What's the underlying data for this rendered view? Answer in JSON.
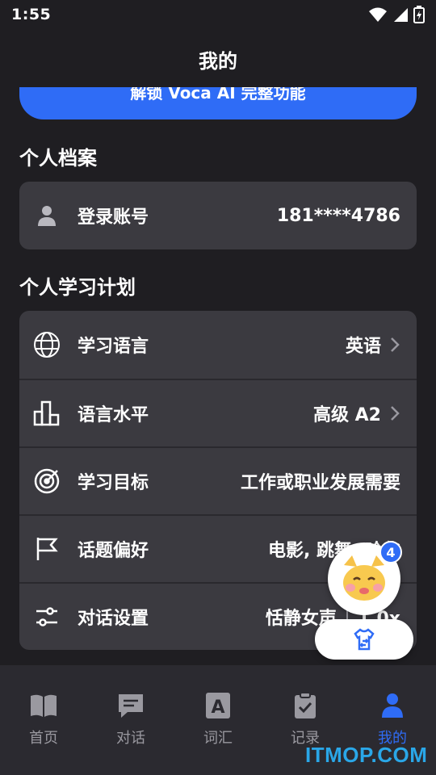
{
  "status": {
    "time": "1:55"
  },
  "header": {
    "title": "我的"
  },
  "unlock": {
    "label": "解锁 Voca AI 完整功能"
  },
  "profile": {
    "section_title": "个人档案",
    "account_label": "登录账号",
    "account_value": "181****4786"
  },
  "plan": {
    "section_title": "个人学习计划",
    "rows": [
      {
        "label": "学习语言",
        "value": "英语",
        "icon": "globe-icon"
      },
      {
        "label": "语言水平",
        "value": "高级 A2",
        "icon": "bar-chart-icon"
      },
      {
        "label": "学习目标",
        "value": "工作或职业发展需要",
        "icon": "target-icon"
      },
      {
        "label": "话题偏好",
        "value": "电影, 跳舞, 哈化",
        "icon": "flag-icon"
      },
      {
        "label": "对话设置",
        "value": "恬静女声",
        "value2": "1.0x",
        "icon": "sliders-icon"
      }
    ]
  },
  "floating": {
    "badge_count": "4"
  },
  "nav": {
    "items": [
      {
        "label": "首页",
        "icon": "book-icon"
      },
      {
        "label": "对话",
        "icon": "chat-icon"
      },
      {
        "label": "词汇",
        "icon": "vocab-icon"
      },
      {
        "label": "记录",
        "icon": "clipboard-icon"
      },
      {
        "label": "我的",
        "icon": "user-icon",
        "active": true
      }
    ]
  },
  "watermark": {
    "text": "ITMOP.COM"
  },
  "colors": {
    "accent": "#2f6cf6",
    "background": "#1f1e22",
    "card": "#3b3a40"
  }
}
